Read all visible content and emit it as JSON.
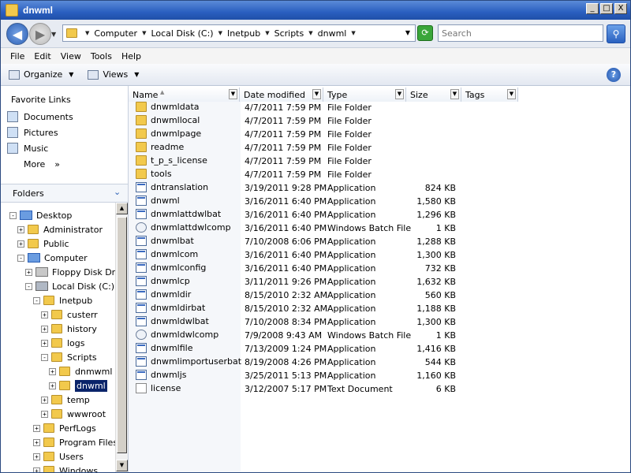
{
  "window": {
    "title": "dnwml"
  },
  "window_buttons": [
    "_",
    "□",
    "X"
  ],
  "address": {
    "crumbs": [
      "Computer",
      "Local Disk (C:)",
      "Inetpub",
      "Scripts",
      "dnwml"
    ],
    "search_placeholder": "Search"
  },
  "menu": [
    "File",
    "Edit",
    "View",
    "Tools",
    "Help"
  ],
  "toolbar": {
    "organize": "Organize",
    "views": "Views",
    "help": "?"
  },
  "favorites": {
    "title": "Favorite Links",
    "items": [
      "Documents",
      "Pictures",
      "Music"
    ],
    "more": "More",
    "more_glyph": "»"
  },
  "folders_header": "Folders",
  "tree": [
    {
      "label": "Desktop",
      "icon": "desktop-icon",
      "expander": "-"
    },
    {
      "label": "Administrator",
      "icon": "user-folder-icon",
      "expander": "+"
    },
    {
      "label": "Public",
      "icon": "folder-icon",
      "expander": "+"
    },
    {
      "label": "Computer",
      "icon": "computer-icon",
      "expander": "-"
    },
    {
      "label": "Floppy Disk Drive",
      "icon": "floppy-icon",
      "expander": "+"
    },
    {
      "label": "Local Disk (C:)",
      "icon": "disk-icon",
      "expander": "-"
    },
    {
      "label": "Inetpub",
      "icon": "folder-icon",
      "expander": "-"
    },
    {
      "label": "custerr",
      "icon": "folder-icon",
      "expander": "+"
    },
    {
      "label": "history",
      "icon": "folder-icon",
      "expander": "+"
    },
    {
      "label": "logs",
      "icon": "folder-icon",
      "expander": "+"
    },
    {
      "label": "Scripts",
      "icon": "folder-icon",
      "expander": "-"
    },
    {
      "label": "dnmwml",
      "icon": "folder-icon",
      "expander": "+"
    },
    {
      "label": "dnwml",
      "icon": "folder-icon",
      "expander": "+",
      "selected": true
    },
    {
      "label": "temp",
      "icon": "folder-icon",
      "expander": "+"
    },
    {
      "label": "wwwroot",
      "icon": "folder-icon",
      "expander": "+"
    },
    {
      "label": "PerfLogs",
      "icon": "folder-icon",
      "expander": "+"
    },
    {
      "label": "Program Files",
      "icon": "folder-icon",
      "expander": "+"
    },
    {
      "label": "Users",
      "icon": "folder-icon",
      "expander": "+"
    },
    {
      "label": "Windows",
      "icon": "folder-icon",
      "expander": "+"
    }
  ],
  "columns": [
    "Name",
    "Date modified",
    "Type",
    "Size",
    "Tags"
  ],
  "files": [
    {
      "name": "dnwmldata",
      "date": "4/7/2011 7:59 PM",
      "type": "File Folder",
      "size": "",
      "icon": "folder"
    },
    {
      "name": "dnwmllocal",
      "date": "4/7/2011 7:59 PM",
      "type": "File Folder",
      "size": "",
      "icon": "folder"
    },
    {
      "name": "dnwmlpage",
      "date": "4/7/2011 7:59 PM",
      "type": "File Folder",
      "size": "",
      "icon": "folder"
    },
    {
      "name": "readme",
      "date": "4/7/2011 7:59 PM",
      "type": "File Folder",
      "size": "",
      "icon": "folder"
    },
    {
      "name": "t_p_s_license",
      "date": "4/7/2011 7:59 PM",
      "type": "File Folder",
      "size": "",
      "icon": "folder"
    },
    {
      "name": "tools",
      "date": "4/7/2011 7:59 PM",
      "type": "File Folder",
      "size": "",
      "icon": "folder"
    },
    {
      "name": "dntranslation",
      "date": "3/19/2011 9:28 PM",
      "type": "Application",
      "size": "824 KB",
      "icon": "app"
    },
    {
      "name": "dnwml",
      "date": "3/16/2011 6:40 PM",
      "type": "Application",
      "size": "1,580 KB",
      "icon": "app"
    },
    {
      "name": "dnwmlattdwlbat",
      "date": "3/16/2011 6:40 PM",
      "type": "Application",
      "size": "1,296 KB",
      "icon": "app"
    },
    {
      "name": "dnwmlattdwlcomp",
      "date": "3/16/2011 6:40 PM",
      "type": "Windows Batch File",
      "size": "1 KB",
      "icon": "bat"
    },
    {
      "name": "dnwmlbat",
      "date": "7/10/2008 6:06 PM",
      "type": "Application",
      "size": "1,288 KB",
      "icon": "app"
    },
    {
      "name": "dnwmlcom",
      "date": "3/16/2011 6:40 PM",
      "type": "Application",
      "size": "1,300 KB",
      "icon": "app"
    },
    {
      "name": "dnwmlconfig",
      "date": "3/16/2011 6:40 PM",
      "type": "Application",
      "size": "732 KB",
      "icon": "app"
    },
    {
      "name": "dnwmlcp",
      "date": "3/11/2011 9:26 PM",
      "type": "Application",
      "size": "1,632 KB",
      "icon": "app"
    },
    {
      "name": "dnwmldir",
      "date": "8/15/2010 2:32 AM",
      "type": "Application",
      "size": "560 KB",
      "icon": "app"
    },
    {
      "name": "dnwmldirbat",
      "date": "8/15/2010 2:32 AM",
      "type": "Application",
      "size": "1,188 KB",
      "icon": "app"
    },
    {
      "name": "dnwmldwlbat",
      "date": "7/10/2008 8:34 PM",
      "type": "Application",
      "size": "1,300 KB",
      "icon": "app"
    },
    {
      "name": "dnwmldwlcomp",
      "date": "7/9/2008 9:43 AM",
      "type": "Windows Batch File",
      "size": "1 KB",
      "icon": "bat"
    },
    {
      "name": "dnwmlfile",
      "date": "7/13/2009 1:24 PM",
      "type": "Application",
      "size": "1,416 KB",
      "icon": "app"
    },
    {
      "name": "dnwmlimportuserbat",
      "date": "8/19/2008 4:26 PM",
      "type": "Application",
      "size": "544 KB",
      "icon": "app"
    },
    {
      "name": "dnwmljs",
      "date": "3/25/2011 5:13 PM",
      "type": "Application",
      "size": "1,160 KB",
      "icon": "app"
    },
    {
      "name": "license",
      "date": "3/12/2007 5:17 PM",
      "type": "Text Document",
      "size": "6 KB",
      "icon": "txt"
    }
  ]
}
